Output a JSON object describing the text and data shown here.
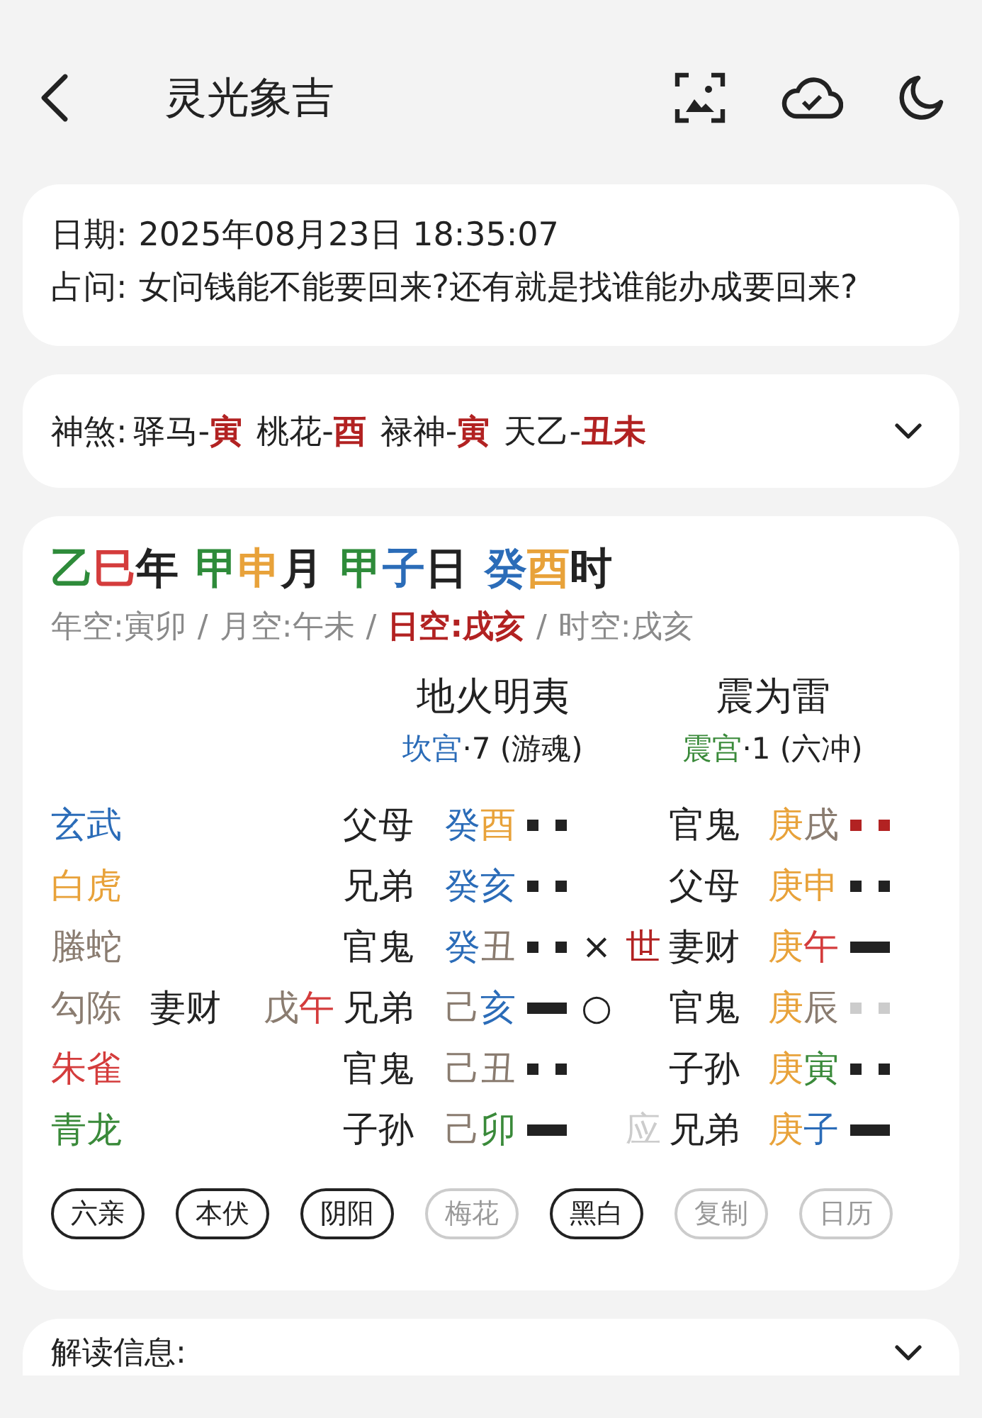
{
  "header": {
    "title": "灵光象吉"
  },
  "info": {
    "date_label": "日期:",
    "date": "2025年08月23日 18:35:07",
    "question_label": "占问:",
    "question": "女问钱能不能要回来?还有就是找谁能办成要回来?"
  },
  "shensha": {
    "label": "神煞:",
    "expanded": false,
    "items": [
      {
        "name": "驿马-",
        "branch": "寅",
        "color": "#b22222"
      },
      {
        "name": "桃花-",
        "branch": "酉",
        "color": "#b22222"
      },
      {
        "name": "禄神-",
        "branch": "寅",
        "color": "#b22222"
      },
      {
        "name": "天乙-",
        "branch": "丑未",
        "color": "#b22222"
      }
    ]
  },
  "pillars": [
    [
      {
        "text": "乙",
        "color": "#2e8b3a"
      },
      {
        "text": "巳",
        "color": "#d43c3c"
      },
      {
        "text": "年",
        "color": "#222222"
      }
    ],
    [
      {
        "text": "甲",
        "color": "#2e8b3a"
      },
      {
        "text": "申",
        "color": "#e8a23a"
      },
      {
        "text": "月",
        "color": "#222222"
      }
    ],
    [
      {
        "text": "甲",
        "color": "#2e8b3a"
      },
      {
        "text": "子",
        "color": "#2b6cb8"
      },
      {
        "text": "日",
        "color": "#222222"
      }
    ],
    [
      {
        "text": "癸",
        "color": "#2b6cb8"
      },
      {
        "text": "酉",
        "color": "#e8a23a"
      },
      {
        "text": "时",
        "color": "#222222"
      }
    ]
  ],
  "voids": [
    {
      "kind": "item",
      "text": "年空:寅卯",
      "highlighted": false
    },
    {
      "kind": "sep",
      "text": "/"
    },
    {
      "kind": "item",
      "text": "月空:午未",
      "highlighted": false
    },
    {
      "kind": "sep",
      "text": "/"
    },
    {
      "kind": "item",
      "text": "日空:戌亥",
      "highlighted": true
    },
    {
      "kind": "sep",
      "text": "/"
    },
    {
      "kind": "item",
      "text": "时空:戌亥",
      "highlighted": false
    }
  ],
  "hexagrams": [
    {
      "name": "地火明夷",
      "palace": {
        "text": "坎宫",
        "color": "#2b6cb8"
      },
      "detail": "·7 (游魂)"
    },
    {
      "name": "震为雷",
      "palace": {
        "text": "震宫",
        "color": "#3a8a3a"
      },
      "detail": "·1 (六冲)"
    }
  ],
  "rows": [
    {
      "spirit": {
        "text": "玄武",
        "color": "#2b6cb8"
      },
      "left": {
        "relation": "父母",
        "stem": {
          "text": "癸",
          "color": "#2b6cb8"
        },
        "branch": {
          "text": "酉",
          "color": "#e8a23a"
        },
        "line": {
          "kind": "yin",
          "color": "#222222"
        }
      },
      "right": {
        "relation": "官鬼",
        "stem": {
          "text": "庚",
          "color": "#e8a23a"
        },
        "branch": {
          "text": "戌",
          "color": "#8a7c70"
        },
        "line": {
          "kind": "yin",
          "color": "#b22222"
        }
      }
    },
    {
      "spirit": {
        "text": "白虎",
        "color": "#e8a23a"
      },
      "left": {
        "relation": "兄弟",
        "stem": {
          "text": "癸",
          "color": "#2b6cb8"
        },
        "branch": {
          "text": "亥",
          "color": "#2b6cb8"
        },
        "line": {
          "kind": "yin",
          "color": "#222222"
        }
      },
      "right": {
        "relation": "父母",
        "stem": {
          "text": "庚",
          "color": "#e8a23a"
        },
        "branch": {
          "text": "申",
          "color": "#e8a23a"
        },
        "line": {
          "kind": "yin",
          "color": "#222222"
        }
      }
    },
    {
      "spirit": {
        "text": "螣蛇",
        "color": "#8a7c70"
      },
      "left": {
        "relation": "官鬼",
        "stem": {
          "text": "癸",
          "color": "#2b6cb8"
        },
        "branch": {
          "text": "丑",
          "color": "#8a7c70"
        },
        "line": {
          "kind": "yin",
          "color": "#222222"
        }
      },
      "moving": {
        "text": "×"
      },
      "position": {
        "text": "世",
        "color": "#b22222"
      },
      "right": {
        "relation": "妻财",
        "stem": {
          "text": "庚",
          "color": "#e8a23a"
        },
        "branch": {
          "text": "午",
          "color": "#d43c3c"
        },
        "line": {
          "kind": "yang",
          "color": "#222222"
        }
      }
    },
    {
      "spirit": {
        "text": "勾陈",
        "color": "#8a7c70"
      },
      "hidden": {
        "relation": "妻财",
        "stem": {
          "text": "戊",
          "color": "#8a7c70"
        },
        "branch": {
          "text": "午",
          "color": "#d43c3c"
        }
      },
      "left": {
        "relation": "兄弟",
        "stem": {
          "text": "己",
          "color": "#8a7c70"
        },
        "branch": {
          "text": "亥",
          "color": "#2b6cb8"
        },
        "line": {
          "kind": "yang",
          "color": "#222222"
        }
      },
      "moving": {
        "text": "○"
      },
      "right": {
        "relation": "官鬼",
        "stem": {
          "text": "庚",
          "color": "#e8a23a"
        },
        "branch": {
          "text": "辰",
          "color": "#8a7c70"
        },
        "line": {
          "kind": "yin",
          "color": "#cccccc"
        }
      }
    },
    {
      "spirit": {
        "text": "朱雀",
        "color": "#d43c3c"
      },
      "left": {
        "relation": "官鬼",
        "stem": {
          "text": "己",
          "color": "#8a7c70"
        },
        "branch": {
          "text": "丑",
          "color": "#8a7c70"
        },
        "line": {
          "kind": "yin",
          "color": "#222222"
        }
      },
      "right": {
        "relation": "子孙",
        "stem": {
          "text": "庚",
          "color": "#e8a23a"
        },
        "branch": {
          "text": "寅",
          "color": "#3a8a3a"
        },
        "line": {
          "kind": "yin",
          "color": "#222222"
        }
      }
    },
    {
      "spirit": {
        "text": "青龙",
        "color": "#3a8a3a"
      },
      "left": {
        "relation": "子孙",
        "stem": {
          "text": "己",
          "color": "#8a7c70"
        },
        "branch": {
          "text": "卯",
          "color": "#3a8a3a"
        },
        "line": {
          "kind": "yang",
          "color": "#222222"
        }
      },
      "position": {
        "text": "应",
        "color": "#cccccc"
      },
      "right": {
        "relation": "兄弟",
        "stem": {
          "text": "庚",
          "color": "#e8a23a"
        },
        "branch": {
          "text": "子",
          "color": "#2b6cb8"
        },
        "line": {
          "kind": "yang",
          "color": "#222222"
        }
      }
    }
  ],
  "chips": [
    {
      "label": "六亲",
      "selected": true
    },
    {
      "label": "本伏",
      "selected": true
    },
    {
      "label": "阴阳",
      "selected": true
    },
    {
      "label": "梅花",
      "selected": false
    },
    {
      "label": "黑白",
      "selected": true
    },
    {
      "label": "复制",
      "selected": false
    },
    {
      "label": "日历",
      "selected": false
    }
  ],
  "reading": {
    "title": "解读信息:",
    "expanded": false
  }
}
